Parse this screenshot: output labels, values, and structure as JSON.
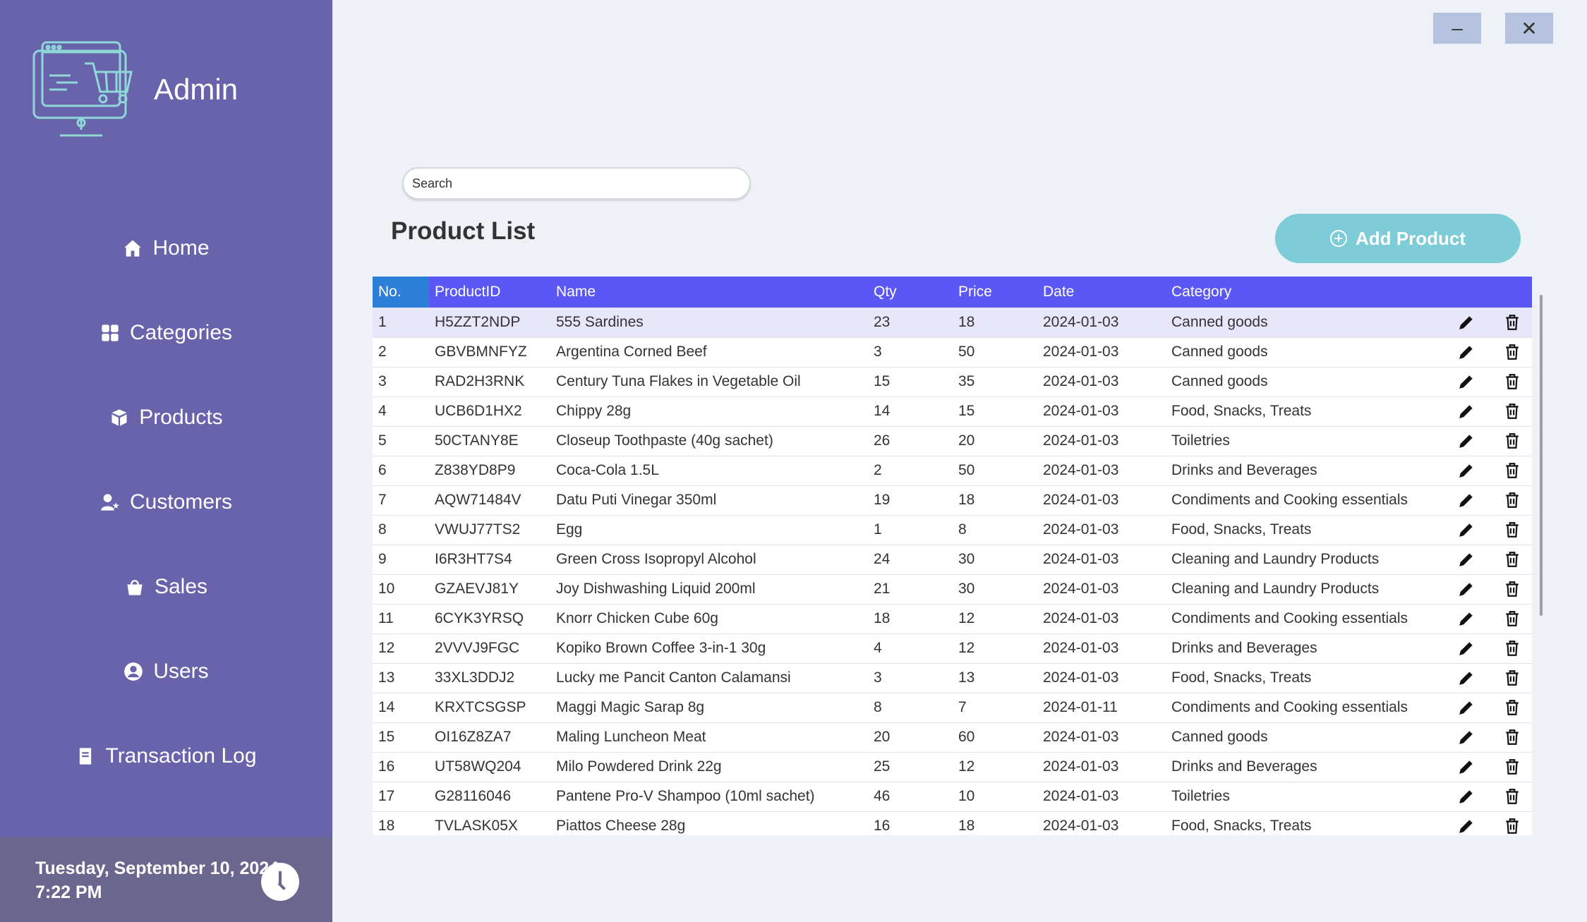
{
  "app": {
    "title": "Admin"
  },
  "window_controls": {
    "minimize": "–",
    "close": "✕"
  },
  "nav": {
    "items": [
      {
        "label": "Home",
        "icon": "home-icon"
      },
      {
        "label": "Categories",
        "icon": "categories-icon"
      },
      {
        "label": "Products",
        "icon": "products-icon"
      },
      {
        "label": "Customers",
        "icon": "customers-icon"
      },
      {
        "label": "Sales",
        "icon": "sales-icon"
      },
      {
        "label": "Users",
        "icon": "users-icon"
      },
      {
        "label": "Transaction Log",
        "icon": "transaction-log-icon"
      }
    ]
  },
  "footer": {
    "date": "Tuesday, September 10, 2024",
    "time": "7:22 PM"
  },
  "search": {
    "placeholder": "Search"
  },
  "main": {
    "title": "Product List",
    "add_button": "Add Product"
  },
  "colors": {
    "sidebar": "#6963ac",
    "header": "#5b57f5",
    "accent": "#7dccd7",
    "selected_row": "#e8e6fb"
  },
  "table": {
    "columns": [
      "No.",
      "ProductID",
      "Name",
      "Qty",
      "Price",
      "Date",
      "Category"
    ],
    "rows": [
      [
        "1",
        "H5ZZT2NDP",
        "555 Sardines",
        "23",
        "18",
        "2024-01-03",
        "Canned goods"
      ],
      [
        "2",
        "GBVBMNFYZ",
        "Argentina Corned Beef",
        "3",
        "50",
        "2024-01-03",
        "Canned goods"
      ],
      [
        "3",
        "RAD2H3RNK",
        "Century Tuna Flakes in Vegetable Oil",
        "15",
        "35",
        "2024-01-03",
        "Canned goods"
      ],
      [
        "4",
        "UCB6D1HX2",
        "Chippy 28g",
        "14",
        "15",
        "2024-01-03",
        "Food, Snacks, Treats"
      ],
      [
        "5",
        "50CTANY8E",
        "Closeup Toothpaste (40g sachet)",
        "26",
        "20",
        "2024-01-03",
        "Toiletries"
      ],
      [
        "6",
        "Z838YD8P9",
        "Coca-Cola 1.5L",
        "2",
        "50",
        "2024-01-03",
        "Drinks and Beverages"
      ],
      [
        "7",
        "AQW71484V",
        "Datu Puti Vinegar 350ml",
        "19",
        "18",
        "2024-01-03",
        "Condiments and Cooking essentials"
      ],
      [
        "8",
        "VWUJ77TS2",
        "Egg",
        "1",
        "8",
        "2024-01-03",
        "Food, Snacks, Treats"
      ],
      [
        "9",
        "I6R3HT7S4",
        "Green Cross Isopropyl Alcohol",
        "24",
        "30",
        "2024-01-03",
        "Cleaning and Laundry Products"
      ],
      [
        "10",
        "GZAEVJ81Y",
        "Joy Dishwashing Liquid 200ml",
        "21",
        "30",
        "2024-01-03",
        "Cleaning and Laundry Products"
      ],
      [
        "11",
        "6CYK3YRSQ",
        "Knorr Chicken Cube 60g",
        "18",
        "12",
        "2024-01-03",
        "Condiments and Cooking essentials"
      ],
      [
        "12",
        "2VVVJ9FGC",
        "Kopiko Brown Coffee 3-in-1 30g",
        "4",
        "12",
        "2024-01-03",
        "Drinks and Beverages"
      ],
      [
        "13",
        "33XL3DDJ2",
        "Lucky me Pancit Canton Calamansi",
        "3",
        "13",
        "2024-01-03",
        "Food, Snacks, Treats"
      ],
      [
        "14",
        "KRXTCSGSP",
        "Maggi Magic Sarap 8g",
        "8",
        "7",
        "2024-01-11",
        "Condiments and Cooking essentials"
      ],
      [
        "15",
        "OI16Z8ZA7",
        "Maling Luncheon Meat",
        "20",
        "60",
        "2024-01-03",
        "Canned goods"
      ],
      [
        "16",
        "UT58WQ204",
        "Milo Powdered Drink 22g",
        "25",
        "12",
        "2024-01-03",
        "Drinks and Beverages"
      ],
      [
        "17",
        "G28116046",
        "Pantene Pro-V Shampoo (10ml sachet)",
        "46",
        "10",
        "2024-01-03",
        "Toiletries"
      ],
      [
        "18",
        "TVLASK05X",
        "Piattos Cheese 28g",
        "16",
        "18",
        "2024-01-03",
        "Food, Snacks, Treats"
      ]
    ]
  }
}
